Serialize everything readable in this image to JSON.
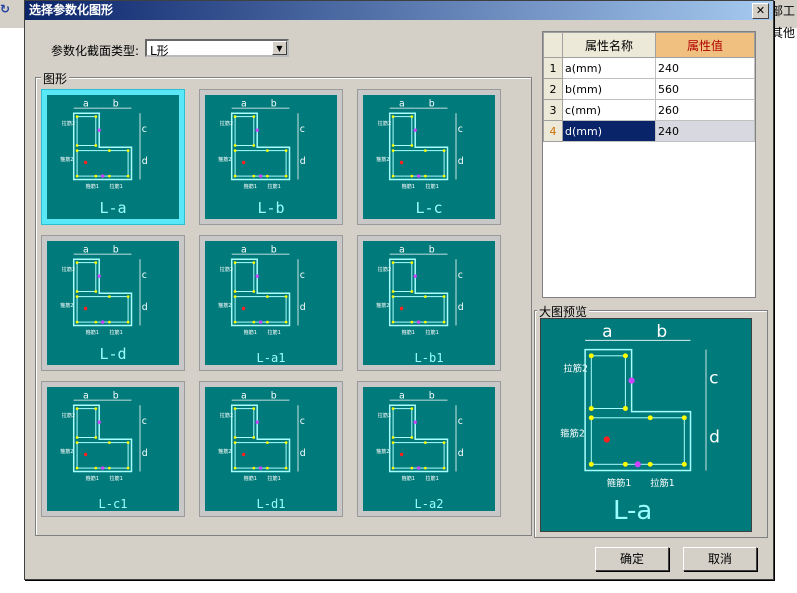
{
  "dialog": {
    "title": "选择参数化图形",
    "close_glyph": "✕"
  },
  "background": {
    "right_top_text": "局部工",
    "right_mid_text": "刘其他",
    "left_icon_text": "终"
  },
  "section_type": {
    "label": "参数化截面类型:",
    "value": "L形"
  },
  "shapes_group": {
    "legend": "图形",
    "tiles": [
      {
        "label": "L-a",
        "selected": true
      },
      {
        "label": "L-b",
        "selected": false
      },
      {
        "label": "L-c",
        "selected": false
      },
      {
        "label": "L-d",
        "selected": false
      },
      {
        "label": "L-a1",
        "selected": false
      },
      {
        "label": "L-b1",
        "selected": false
      },
      {
        "label": "L-c1",
        "selected": false
      },
      {
        "label": "L-d1",
        "selected": false
      },
      {
        "label": "L-a2",
        "selected": false
      }
    ],
    "texts": {
      "a": "a",
      "b": "b",
      "c": "c",
      "d": "d",
      "hoop1": "箍筋1",
      "hoop2": "箍筋2",
      "tie1": "拉筋1",
      "tie2": "拉筋2",
      "jd": "jd",
      "hoop3": "箍筋3",
      "hoop4": "箍筋4",
      "tie3": "拉筋3"
    }
  },
  "properties": {
    "header_name": "属性名称",
    "header_value": "属性值",
    "rows": [
      {
        "index": "1",
        "name": "a(mm)",
        "value": "240"
      },
      {
        "index": "2",
        "name": "b(mm)",
        "value": "560"
      },
      {
        "index": "3",
        "name": "c(mm)",
        "value": "260"
      },
      {
        "index": "4",
        "name": "d(mm)",
        "value": "240",
        "selected": true
      }
    ]
  },
  "preview": {
    "legend": "大图预览",
    "label": "L-a"
  },
  "buttons": {
    "ok": "确定",
    "cancel": "取消"
  },
  "colors": {
    "teal": "#007a7a",
    "outline": "#a8ffff",
    "rebar": "#ffff00",
    "tie": "#cc44ff",
    "core": "#ff2020",
    "selected_tile": "#5ae8f8"
  }
}
